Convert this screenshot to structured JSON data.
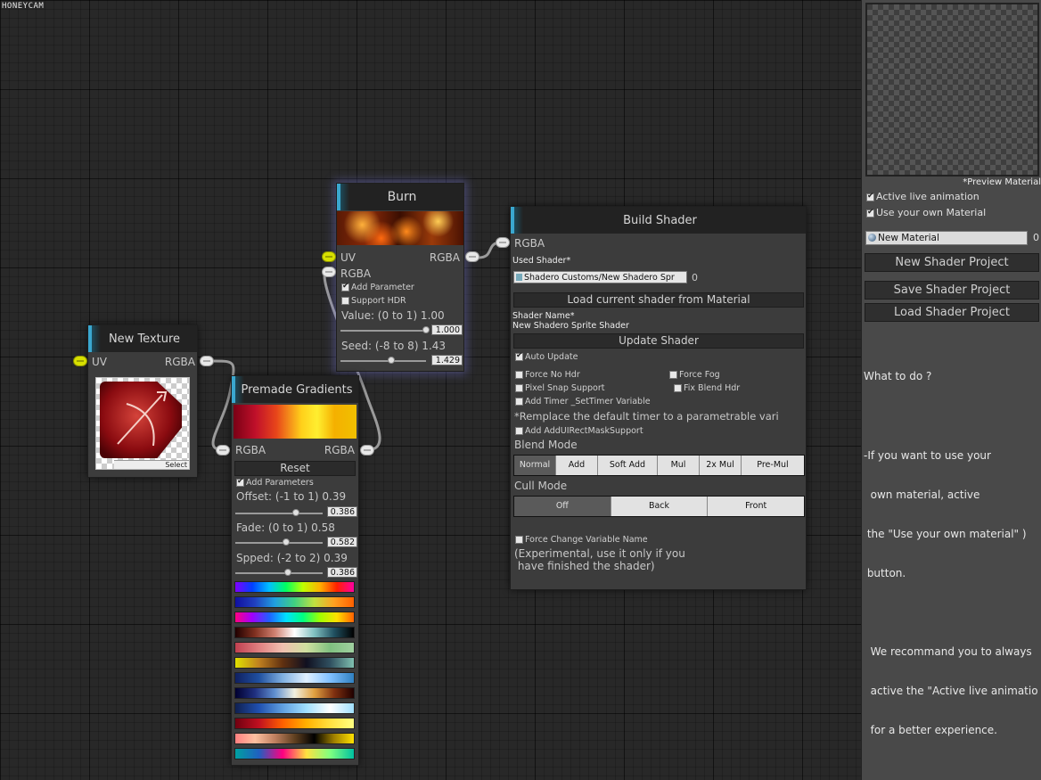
{
  "watermark": "HONEYCAM",
  "nodes": {
    "new_texture": {
      "title": "New Texture",
      "uv": "UV",
      "rgba": "RGBA",
      "select": "Select"
    },
    "burn": {
      "title": "Burn",
      "uv": "UV",
      "rgba_out": "RGBA",
      "rgba_in": "RGBA",
      "add_parameter": "Add Parameter",
      "support_hdr": "Support HDR",
      "value_label": "Value: (0 to 1) 1.00",
      "value_box": "1.000",
      "value_level": 1.0,
      "seed_label": "Seed: (-8 to 8) 1.43",
      "seed_box": "1.429",
      "seed_level": 0.589
    },
    "premade_gradients": {
      "title": "Premade Gradients",
      "rgba_in": "RGBA",
      "rgba_out": "RGBA",
      "reset": "Reset",
      "add_parameters": "Add Parameters",
      "offset_label": "Offset: (-1 to 1) 0.39",
      "offset_box": "0.386",
      "offset_level": 0.693,
      "fade_label": "Fade: (0 to 1) 0.58",
      "fade_box": "0.582",
      "fade_level": 0.582,
      "speed_label": "Spped: (-2 to 2) 0.39",
      "speed_box": "0.386",
      "speed_level": 0.597
    },
    "build_shader": {
      "title": "Build Shader",
      "rgba": "RGBA",
      "used_shader_label": "Used Shader*",
      "used_shader_value": "Shadero Customs/New Shadero Spr",
      "used_shader_count": "0",
      "load_current": "Load current shader from Material",
      "shader_name_label": "Shader Name*",
      "shader_name_value": "New Shadero Sprite Shader",
      "update_shader": "Update Shader",
      "auto_update": "Auto Update",
      "force_no_hdr": "Force No Hdr",
      "force_fog": "Force Fog",
      "pixel_snap": "Pixel Snap Support",
      "fix_blend_hdr": "Fix Blend Hdr",
      "add_timer": "Add Timer _SetTimer Variable",
      "timer_note": "*Remplace the default timer to a parametrable vari",
      "add_rectmask": "Add AddUIRectMaskSupport",
      "blend_mode_label": "Blend Mode",
      "blend_modes": [
        "Normal",
        "Add",
        "Soft Add",
        "Mul",
        "2x Mul",
        "Pre-Mul"
      ],
      "blend_selected": "Normal",
      "cull_mode_label": "Cull Mode",
      "cull_modes": [
        "Off",
        "Back",
        "Front"
      ],
      "cull_selected": "Off",
      "force_change": "Force Change Variable Name",
      "experimental_1": "(Experimental, use it only if you",
      "experimental_2": " have finished the shader)"
    }
  },
  "panel": {
    "preview_label": "*Preview Material",
    "active_live": "Active live animation",
    "use_own_material": "Use your own Material",
    "material_field": "New Material",
    "material_count": "0",
    "new_project": "New Shader Project",
    "save_project": "Save Shader Project",
    "load_project": "Load Shader Project",
    "help": [
      "What to do ?",
      "",
      "-If you want to use your",
      "  own material, active",
      " the \"Use your own material\" )",
      " button.",
      "",
      "  We recommand you to always",
      "  active the \"Active live animatio",
      "  for a better experience."
    ]
  },
  "colors": {
    "accent": "#3aa7cf",
    "node_bg": "#3c3c3c",
    "canvas_bg": "#282828",
    "panel_bg": "#494949",
    "port_yellow": "#d8e000"
  }
}
